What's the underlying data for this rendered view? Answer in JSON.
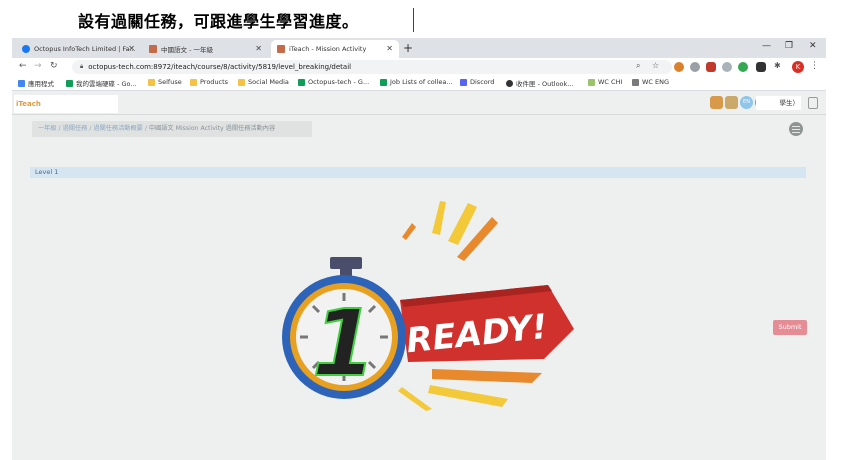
{
  "caption": "設有過關任務，可跟進學生學習進度。",
  "tabs": [
    {
      "title": "Octopus InfoTech Limited | Fa..."
    },
    {
      "title": "中國語文 - 一年級"
    },
    {
      "title": "iTeach - Mission Activity"
    }
  ],
  "omnibox": {
    "url": "octopus-tech.com:8972/iteach/course/8/activity/5819/level_breaking/detail"
  },
  "bookmarks": [
    "應用程式",
    "我的雲端硬碟 - Go...",
    "Selfuse",
    "Products",
    "Social Media",
    "Octopus-tech - G...",
    "Job Lists of collea...",
    "Discord",
    "收件匣 - Outlook...",
    "WC CHI",
    "WC ENG"
  ],
  "profile_initial": "K",
  "header": {
    "logo_text": "iTeach",
    "lang_label": "EN",
    "lang_label2": "中",
    "user_suffix": "學生）"
  },
  "breadcrumb": {
    "items": [
      "一年級",
      "過關任務",
      "過關任務活動概要"
    ],
    "sep": "/",
    "current": "中國語文 Mission Activity 過關任務活動內容"
  },
  "level": {
    "label": "Level 1"
  },
  "ready": {
    "number": "1",
    "word": "READY!"
  },
  "submit_label": "Submit",
  "colors": {
    "ribbon": "#d0312d",
    "clock_ring": "#2d63b8",
    "clock_inner": "#e8a020",
    "submit": "#e58c95"
  }
}
